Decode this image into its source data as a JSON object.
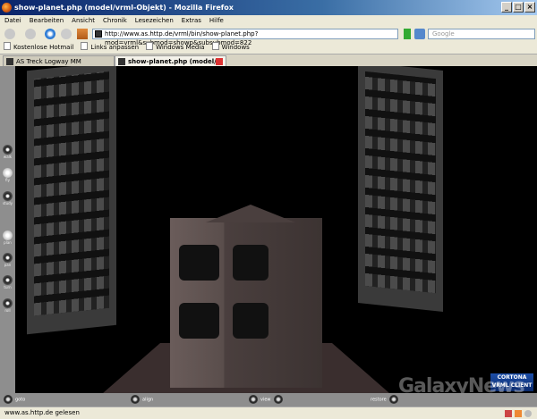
{
  "window": {
    "title": "show-planet.php (model/vrml-Objekt) - Mozilla Firefox",
    "buttons": [
      "_",
      "□",
      "×"
    ]
  },
  "menu": [
    "Datei",
    "Bearbeiten",
    "Ansicht",
    "Chronik",
    "Lesezeichen",
    "Extras",
    "Hilfe"
  ],
  "nav": {
    "url": "http://www.as.http.de/vrml/bin/show-planet.php?mod=vrml&submod=showp&subsubmod=822",
    "search_placeholder": "Google"
  },
  "bookmarks": [
    "Kostenlose Hotmail",
    "Links anpassen",
    "Windows Media",
    "Windows"
  ],
  "tabs": [
    {
      "label": "AS Treck Logway MM",
      "active": false
    },
    {
      "label": "show-planet.php (model/...",
      "active": true
    }
  ],
  "cortona": {
    "left_nav": [
      "walk",
      "fly",
      "study",
      "plan",
      "pan",
      "turn",
      "roll"
    ],
    "bottom": {
      "goto": "goto",
      "align": "align",
      "view": "view",
      "restore": "restore"
    },
    "logo": "CORTONA VRML CLIENT"
  },
  "watermark": "GalaxyNews",
  "status": {
    "text": "www.as.http.de gelesen"
  }
}
